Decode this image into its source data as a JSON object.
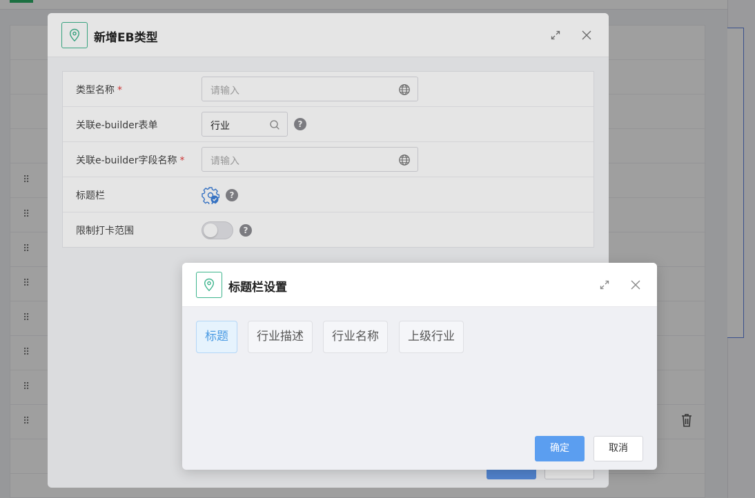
{
  "outer_dialog": {
    "title": "新增EB类型",
    "fields": {
      "type_name": {
        "label": "类型名称",
        "required": "*",
        "placeholder": "请输入"
      },
      "eb_form": {
        "label": "关联e-builder表单",
        "value": "行业",
        "help": "?"
      },
      "eb_field": {
        "label": "关联e-builder字段名称",
        "required": "*",
        "placeholder": "请输入"
      },
      "title_bar": {
        "label": "标题栏",
        "help": "?"
      },
      "limit_range": {
        "label": "限制打卡范围",
        "help": "?"
      }
    }
  },
  "inner_dialog": {
    "title": "标题栏设置",
    "tags": [
      "标题",
      "行业描述",
      "行业名称",
      "上级行业"
    ],
    "confirm_label": "确定",
    "cancel_label": "取消"
  },
  "colors": {
    "accent": "#5b9ef0",
    "logo": "#3cb48c",
    "required": "#e23b3b",
    "active_tag": "#4a9be3"
  }
}
